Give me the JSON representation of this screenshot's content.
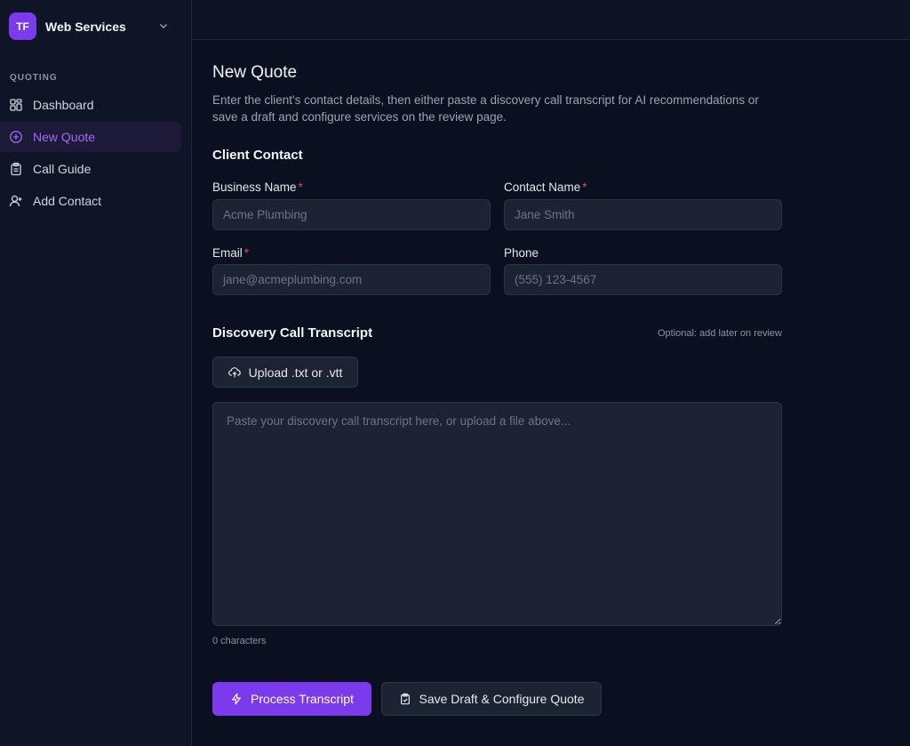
{
  "sidebar": {
    "brand": {
      "initials": "TF",
      "name": "Web Services"
    },
    "section_label": "QUOTING",
    "items": [
      {
        "label": "Dashboard",
        "icon": "grid-icon"
      },
      {
        "label": "New Quote",
        "icon": "plus-circle-icon",
        "active": true
      },
      {
        "label": "Call Guide",
        "icon": "clipboard-icon"
      },
      {
        "label": "Add Contact",
        "icon": "user-plus-icon"
      }
    ]
  },
  "main": {
    "title": "New Quote",
    "intro": "Enter the client's contact details, then either paste a discovery call transcript for AI recommendations or save a draft and configure services on the review page.",
    "client_contact": {
      "heading": "Client Contact",
      "business_name": {
        "label": "Business Name",
        "placeholder": "Acme Plumbing",
        "value": ""
      },
      "contact_name": {
        "label": "Contact Name",
        "placeholder": "Jane Smith",
        "value": ""
      },
      "email": {
        "label": "Email",
        "placeholder": "jane@acmeplumbing.com",
        "value": ""
      },
      "phone": {
        "label": "Phone",
        "placeholder": "(555) 123-4567",
        "value": ""
      },
      "required_marker": "*"
    },
    "transcript": {
      "heading": "Discovery Call Transcript",
      "optional_note": "Optional: add later on review",
      "upload_label": "Upload .txt or .vtt",
      "placeholder": "Paste your discovery call transcript here, or upload a file above...",
      "char_count": "0 characters"
    },
    "actions": {
      "process_label": "Process Transcript",
      "save_label": "Save Draft & Configure Quote"
    }
  },
  "colors": {
    "accent": "#7c3aed",
    "background": "#0b1020",
    "sidebar": "#0f1526",
    "required": "#ef4444"
  }
}
